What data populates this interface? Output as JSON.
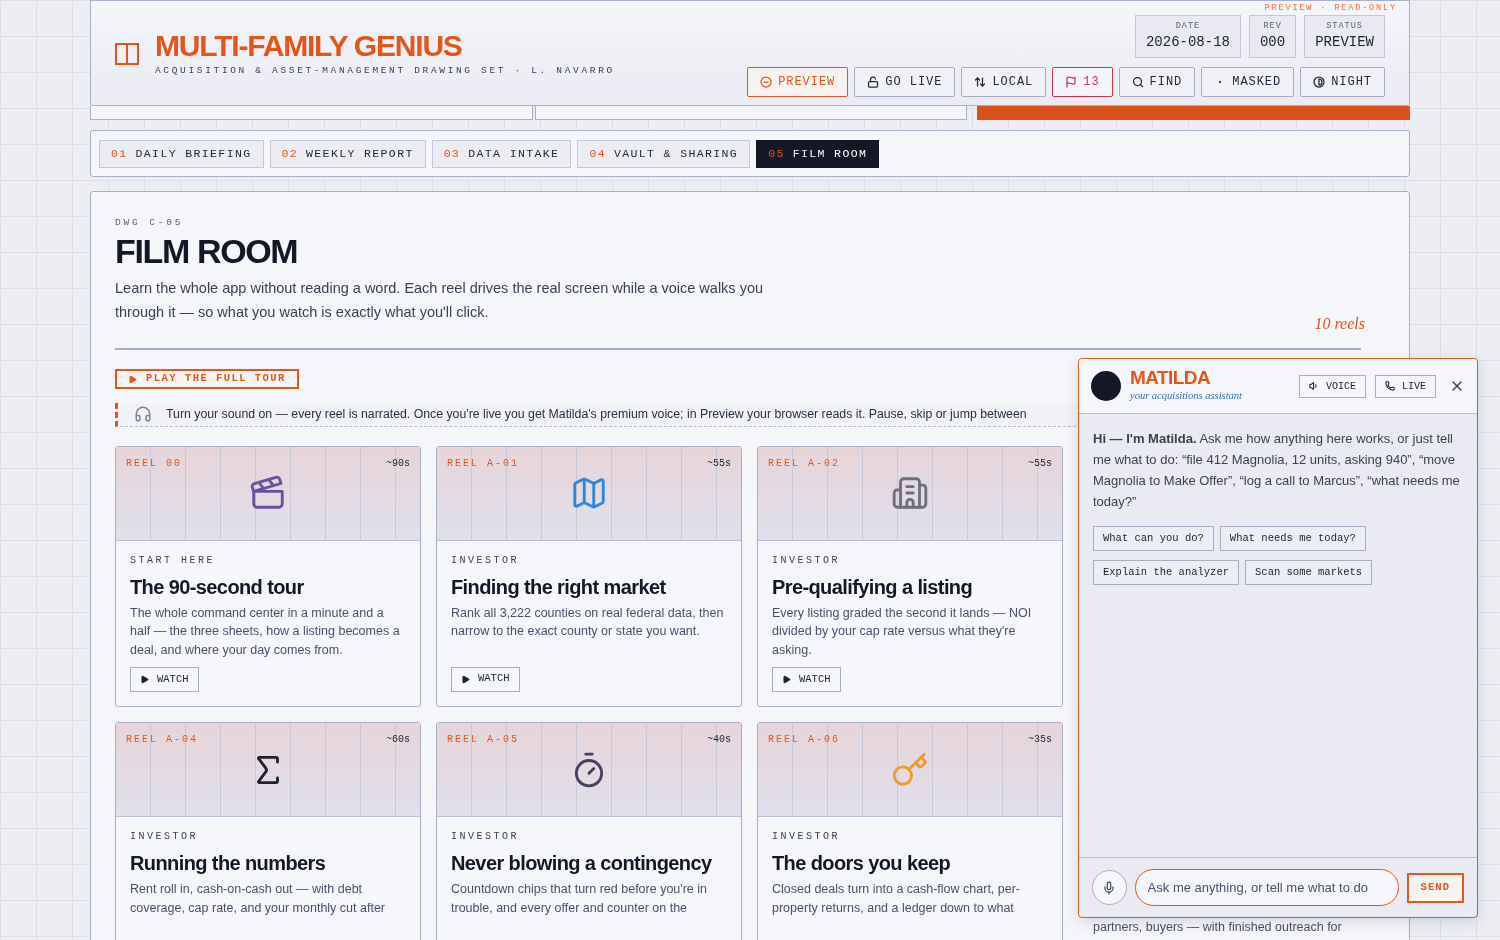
{
  "header": {
    "logo": "MULTI-FAMILY GENIUS",
    "subtitle": "ACQUISITION & ASSET-MANAGEMENT DRAWING SET · L. NAVARRO",
    "mode_note": "PREVIEW · READ-ONLY",
    "meta": [
      {
        "label": "DATE",
        "value": "2026-08-18"
      },
      {
        "label": "REV",
        "value": "000"
      },
      {
        "label": "STATUS",
        "value": "PREVIEW"
      }
    ],
    "buttons": [
      {
        "kind": "preview",
        "label": "PREVIEW",
        "selected": true
      },
      {
        "kind": "lock",
        "label": "GO LIVE",
        "selected": false
      },
      {
        "kind": "sync",
        "label": "LOCAL",
        "selected": false
      },
      {
        "kind": "flag",
        "label": "13",
        "selected": false
      },
      {
        "kind": "search",
        "label": "FIND",
        "selected": false
      },
      {
        "kind": "dot",
        "label": "MASKED",
        "selected": false
      },
      {
        "kind": "contrast",
        "label": "NIGHT",
        "selected": false
      }
    ]
  },
  "tabs": [
    {
      "number": "01",
      "label": "DAILY BRIEFING",
      "selected": false
    },
    {
      "number": "02",
      "label": "WEEKLY REPORT",
      "selected": false
    },
    {
      "number": "03",
      "label": "DATA INTAKE",
      "selected": false
    },
    {
      "number": "04",
      "label": "VAULT & SHARING",
      "selected": false
    },
    {
      "number": "05",
      "label": "FILM ROOM",
      "selected": true
    }
  ],
  "page": {
    "sheet": "DWG C-05",
    "title": "FILM ROOM",
    "intro": "Learn the whole app without reading a word. Each reel drives the real screen while a voice walks you through it — so what you watch is exactly what you'll click.",
    "count": "10 reels",
    "play_button": "PLAY THE FULL TOUR",
    "narration": "Turn your sound on — every reel is narrated. Once you're live you get Matilda's premium voice; in Preview your browser reads it. Pause, skip or jump between"
  },
  "reels": [
    {
      "tag": "REEL 00",
      "duration": "~90s",
      "kind": "clapper",
      "category": "START HERE",
      "title": "The 90-second tour",
      "description": "The whole command center in a minute and a half — the three sheets, how a listing becomes a deal, and where your day comes from.",
      "button": "WATCH"
    },
    {
      "tag": "REEL A-01",
      "duration": "~55s",
      "kind": "map",
      "category": "INVESTOR",
      "title": "Finding the right market",
      "description": "Rank all 3,222 counties on real federal data, then narrow to the exact county or state you want.",
      "button": "WATCH"
    },
    {
      "tag": "REEL A-02",
      "duration": "~55s",
      "kind": "building",
      "category": "INVESTOR",
      "title": "Pre-qualifying a listing",
      "description": "Every listing graded the second it lands — NOI divided by your cap rate versus what they're asking.",
      "button": "WATCH"
    },
    {
      "tag": "REEL A-04",
      "duration": "~60s",
      "kind": "sigma",
      "category": "INVESTOR",
      "title": "Running the numbers",
      "description": "Rent roll in, cash-on-cash out — with debt coverage, cap rate, and your monthly cut after"
    },
    {
      "tag": "REEL A-05",
      "duration": "~40s",
      "kind": "stopwatch",
      "category": "INVESTOR",
      "title": "Never blowing a contingency",
      "description": "Countdown chips that turn red before you're in trouble, and every offer and counter on the"
    },
    {
      "tag": "REEL A-06",
      "duration": "~35s",
      "kind": "key",
      "category": "INVESTOR",
      "title": "The doors you keep",
      "description": "Closed deals turn into a cash-flow chart, per-property returns, and a ledger down to what"
    }
  ],
  "behind_chat_text": "partners, buyers — with finished outreach for",
  "assistant": {
    "name": "MATILDA",
    "tagline": "your acquisitions assistant",
    "buttons": [
      {
        "kind": "voice",
        "label": "VOICE"
      },
      {
        "kind": "phone",
        "label": "LIVE"
      }
    ],
    "message": "**Hi — I'm Matilda.** Ask me how anything here works, or just tell me what to do: “file 412 Magnolia, 12 units, asking 940”, “move Magnolia to Make Offer”, “log a call to Marcus”, “what needs me today?”",
    "suggestions": [
      "What can you do?",
      "What needs me today?",
      "Explain the analyzer",
      "Scan some markets"
    ],
    "input": {
      "placeholder": "Ask me anything, or tell me what to do"
    },
    "send": "SEND"
  }
}
